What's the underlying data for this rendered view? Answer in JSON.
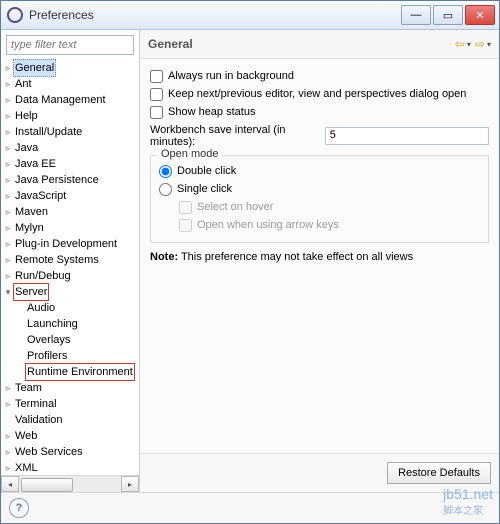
{
  "window": {
    "title": "Preferences"
  },
  "filter": {
    "placeholder": "type filter text"
  },
  "tree": [
    {
      "label": "General",
      "expand": "▹",
      "selected": true
    },
    {
      "label": "Ant",
      "expand": "▹"
    },
    {
      "label": "Data Management",
      "expand": "▹"
    },
    {
      "label": "Help",
      "expand": "▹"
    },
    {
      "label": "Install/Update",
      "expand": "▹"
    },
    {
      "label": "Java",
      "expand": "▹"
    },
    {
      "label": "Java EE",
      "expand": "▹"
    },
    {
      "label": "Java Persistence",
      "expand": "▹"
    },
    {
      "label": "JavaScript",
      "expand": "▹"
    },
    {
      "label": "Maven",
      "expand": "▹"
    },
    {
      "label": "Mylyn",
      "expand": "▹"
    },
    {
      "label": "Plug-in Development",
      "expand": "▹"
    },
    {
      "label": "Remote Systems",
      "expand": "▹"
    },
    {
      "label": "Run/Debug",
      "expand": "▹"
    },
    {
      "label": "Server",
      "expand": "▾",
      "highlight": true
    },
    {
      "label": "Audio",
      "indent": 1
    },
    {
      "label": "Launching",
      "indent": 1
    },
    {
      "label": "Overlays",
      "indent": 1
    },
    {
      "label": "Profilers",
      "indent": 1
    },
    {
      "label": "Runtime Environment",
      "indent": 1,
      "highlight": true
    },
    {
      "label": "Team",
      "expand": "▹"
    },
    {
      "label": "Terminal",
      "expand": "▹"
    },
    {
      "label": "Validation"
    },
    {
      "label": "Web",
      "expand": "▹"
    },
    {
      "label": "Web Services",
      "expand": "▹"
    },
    {
      "label": "XML",
      "expand": "▹"
    }
  ],
  "page": {
    "title": "General",
    "always_run_bg": "Always run in background",
    "keep_next_prev": "Keep next/previous editor, view and perspectives dialog open",
    "show_heap": "Show heap status",
    "save_interval_label": "Workbench save interval (in minutes):",
    "save_interval_value": "5",
    "open_mode": {
      "legend": "Open mode",
      "double": "Double click",
      "single": "Single click",
      "hover": "Select on hover",
      "arrow": "Open when using arrow keys"
    },
    "note_label": "Note:",
    "note_text": " This preference may not take effect on all views",
    "restore_btn": "Restore Defaults"
  },
  "watermark": {
    "site": "jb51.net",
    "tag": "脚本之家"
  }
}
